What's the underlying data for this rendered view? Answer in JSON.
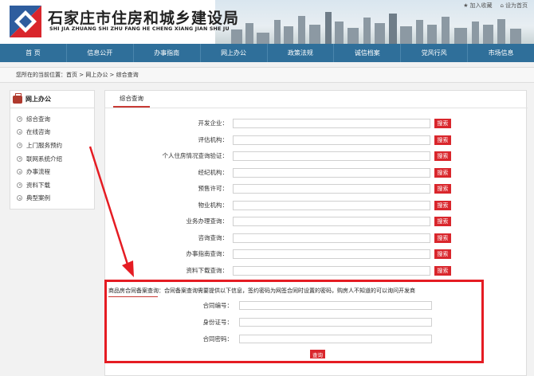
{
  "header": {
    "title": "石家庄市住房和城乡建设局",
    "subtitle": "SHI JIA ZHUANG SHI ZHU FANG HE CHENG XIANG JIAN SHE JU",
    "tools": [
      {
        "label": "加入收藏",
        "icon": "star-icon"
      },
      {
        "label": "设为首页",
        "icon": "home-icon"
      }
    ]
  },
  "nav": {
    "items": [
      "首  页",
      "信息公开",
      "办事指南",
      "网上办公",
      "政策法规",
      "诚信档案",
      "党风行风",
      "市场信息"
    ]
  },
  "breadcrumb": {
    "text": "您所在的当前位置：首页 > 网上办公 > 综合查询"
  },
  "sidebar": {
    "title": "网上办公",
    "items": [
      "综合查询",
      "在线咨询",
      "上门服务预约",
      "联网系统介绍",
      "办事流程",
      "资料下载",
      "典型案例"
    ]
  },
  "main": {
    "tab": "综合查询",
    "search_label": "搜索",
    "rows": [
      {
        "label": "开发企业："
      },
      {
        "label": "评估机构："
      },
      {
        "label": "个人住房情况查询验证："
      },
      {
        "label": "经纪机构："
      },
      {
        "label": "预售许可："
      },
      {
        "label": "物业机构："
      },
      {
        "label": "业务办理查询："
      },
      {
        "label": "咨询查询："
      },
      {
        "label": "办事指南查询："
      },
      {
        "label": "资料下载查询："
      }
    ],
    "contract": {
      "title": "商品房合同备案查询：合同备案查询需要提供以下信息，签约密码为网签合同时设置的密码，购房人不知道的可以询问开发商",
      "fields": [
        {
          "label": "合同编号："
        },
        {
          "label": "身份证号："
        },
        {
          "label": "合同密码："
        }
      ],
      "query_label": "查询"
    }
  },
  "colors": {
    "nav": "#2f6f9a",
    "accent": "#d9262c",
    "highlight": "#e51c23"
  }
}
